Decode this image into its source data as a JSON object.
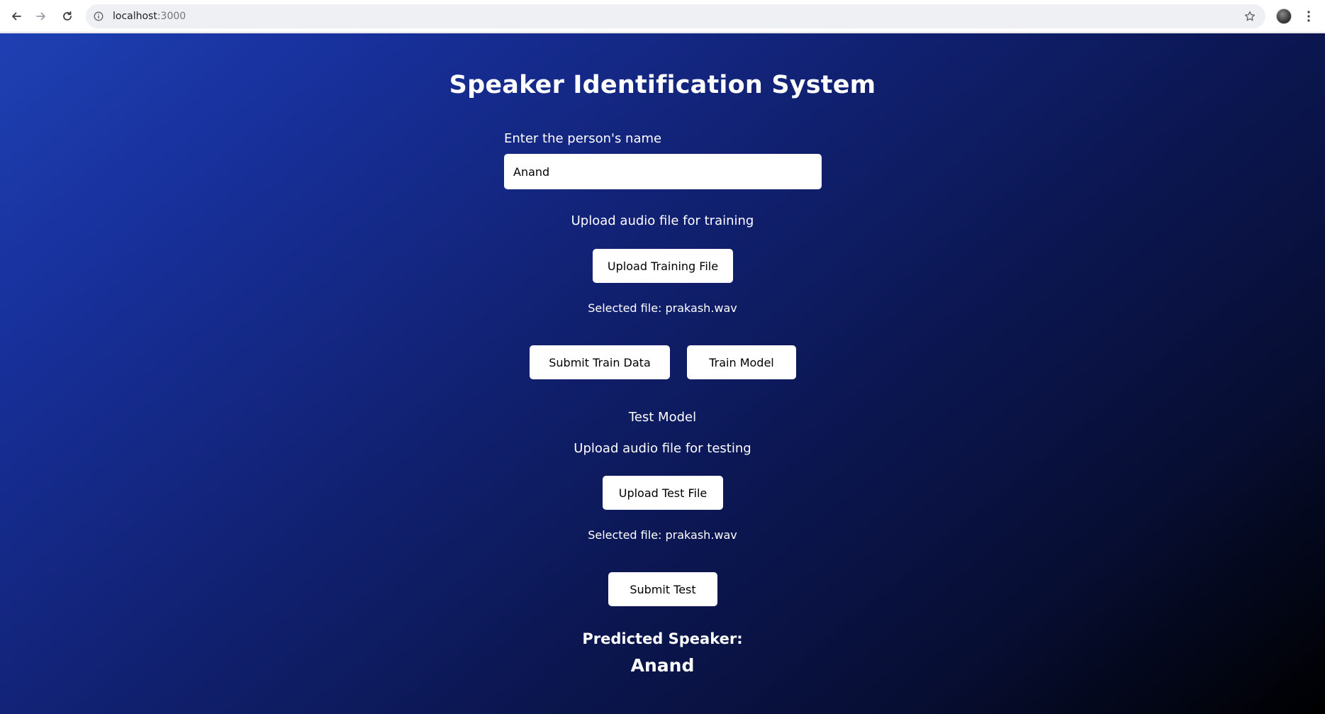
{
  "browser": {
    "url_host": "localhost",
    "url_port": ":3000",
    "icons": {
      "back": "arrow-left-icon",
      "forward": "arrow-right-icon",
      "reload": "reload-icon",
      "site_info": "info-circle-icon",
      "bookmark": "star-icon",
      "profile": "avatar",
      "menu": "kebab-menu-icon"
    }
  },
  "page": {
    "title": "Speaker Identification System",
    "name_label": "Enter the person's name",
    "name_value": "Anand",
    "training": {
      "upload_label": "Upload audio file for training",
      "upload_button": "Upload Training File",
      "selected_file": "Selected file: prakash.wav",
      "submit_button": "Submit Train Data",
      "train_button": "Train Model"
    },
    "testing": {
      "heading": "Test Model",
      "upload_label": "Upload audio file for testing",
      "upload_button": "Upload Test File",
      "selected_file": "Selected file: prakash.wav",
      "submit_button": "Submit Test"
    },
    "result": {
      "label": "Predicted Speaker:",
      "value": "Anand"
    }
  },
  "colors": {
    "gradient_start": "#1f40b3",
    "gradient_end": "#000000",
    "button_bg": "#ffffff",
    "text": "#ffffff"
  }
}
